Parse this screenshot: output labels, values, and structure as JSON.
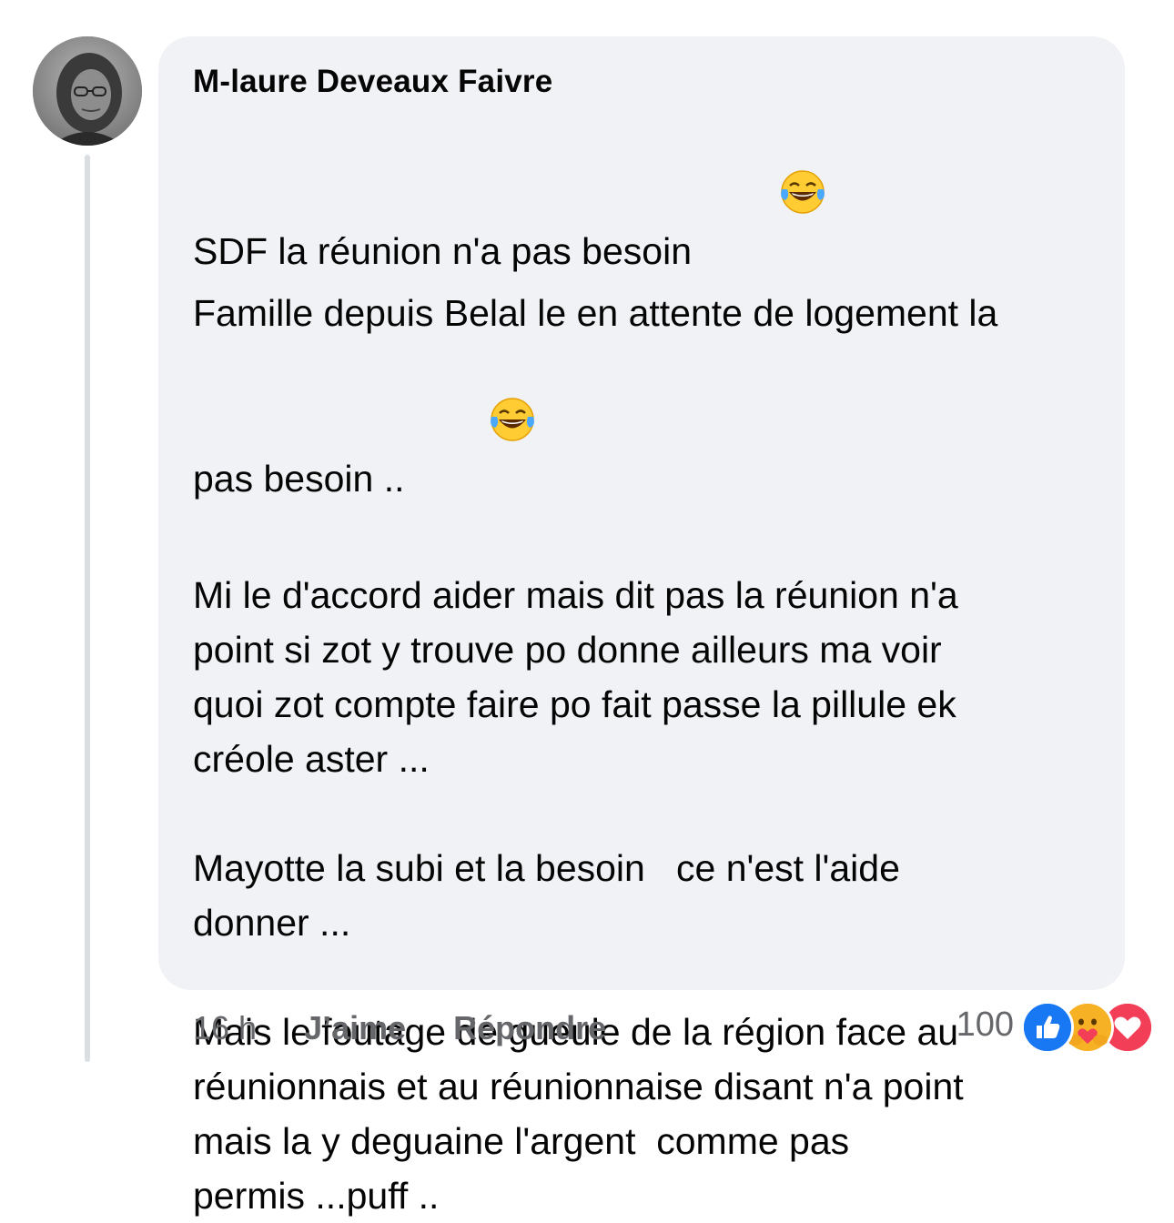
{
  "comment": {
    "author": "M-laure Deveaux Faivre",
    "paragraphs": [
      [
        "SDF la réunion n'a pas besoin",
        "Famille depuis Belal le en attente de logement la",
        "pas besoin .."
      ],
      [
        "Mi le d'accord aider mais dit pas la réunion n'a",
        "point si zot y trouve po donne ailleurs ma voir",
        "quoi zot compte faire po fait passe la pillule ek",
        "créole aster ..."
      ],
      [
        "Mayotte la subi et la besoin   ce n'est l'aide",
        "donner ..."
      ],
      [
        "Mais le foutage de gueule de la région face au",
        "réunionnais et au réunionnaise disant n'a point",
        "mais la y deguaine l'argent  comme pas",
        "permis ...puff .."
      ]
    ],
    "emojis": [
      "laughing-tears-emoji",
      "laughing-tears-emoji"
    ]
  },
  "footer": {
    "time": "16 h",
    "like_label": "J’aime",
    "reply_label": "Répondre"
  },
  "reactions": {
    "count": "100",
    "icons": [
      "like-reaction-icon",
      "care-reaction-icon",
      "love-reaction-icon"
    ],
    "colors": {
      "like": "#1877f2",
      "care": "#f7b125",
      "love": "#f33e58"
    }
  }
}
